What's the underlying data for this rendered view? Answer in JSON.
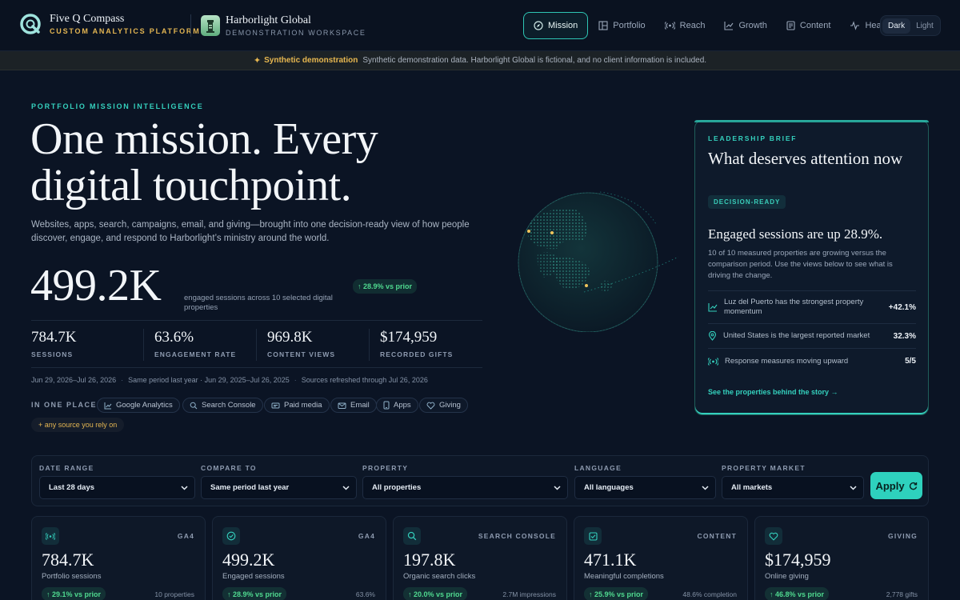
{
  "brand": {
    "name": "Five Q Compass",
    "subtitle": "CUSTOM ANALYTICS PLATFORM"
  },
  "client": {
    "name": "Harborlight Global",
    "subtitle": "DEMONSTRATION WORKSPACE"
  },
  "nav": {
    "items": [
      {
        "label": "Mission",
        "icon": "compass-icon",
        "active": true
      },
      {
        "label": "Portfolio",
        "icon": "grid-icon",
        "active": false
      },
      {
        "label": "Reach",
        "icon": "broadcast-icon",
        "active": false
      },
      {
        "label": "Growth",
        "icon": "trend-up-icon",
        "active": false
      },
      {
        "label": "Content",
        "icon": "document-icon",
        "active": false
      },
      {
        "label": "Health",
        "icon": "pulse-icon",
        "active": false
      }
    ],
    "theme": {
      "dark": "Dark",
      "light": "Light",
      "selected": "Dark"
    }
  },
  "banner": {
    "icon": "sparkle-icon",
    "strong": "Synthetic demonstration",
    "text": "Synthetic demonstration data. Harborlight Global is fictional, and no client information is included."
  },
  "hero": {
    "eyebrow": "PORTFOLIO MISSION INTELLIGENCE",
    "title": "One mission. Every digital touchpoint.",
    "description": "Websites, apps, search, campaigns, email, and giving—brought into one decision-ready view of how people discover, engage, and respond to Harborlight’s ministry around the world."
  },
  "headline_metric": {
    "value": "499.2K",
    "label": "engaged sessions across 10 selected digital properties",
    "change": "↑ 28.9% vs prior"
  },
  "kpis": [
    {
      "value": "784.7K",
      "label": "SESSIONS"
    },
    {
      "value": "63.6%",
      "label": "ENGAGEMENT RATE"
    },
    {
      "value": "969.8K",
      "label": "CONTENT VIEWS"
    },
    {
      "value": "$174,959",
      "label": "RECORDED GIFTS"
    }
  ],
  "meta": {
    "range": "Jun 29, 2026–Jul 26, 2026",
    "compare": "Same period last year · Jun 29, 2025–Jul 26, 2025",
    "refreshed": "Sources refreshed through Jul 26, 2026"
  },
  "sources": {
    "label": "IN ONE PLACE",
    "chips": [
      {
        "label": "Google Analytics",
        "icon": "chart-line-icon"
      },
      {
        "label": "Search Console",
        "icon": "search-icon"
      },
      {
        "label": "Paid media",
        "icon": "ad-icon"
      },
      {
        "label": "Email",
        "icon": "envelope-icon"
      },
      {
        "label": "Apps",
        "icon": "phone-icon"
      },
      {
        "label": "Giving",
        "icon": "heart-icon"
      }
    ],
    "any": "+ any source you rely on"
  },
  "brief": {
    "eyebrow": "LEADERSHIP BRIEF",
    "title": "What deserves attention now",
    "badge": "DECISION-READY",
    "headline": "Engaged sessions are up 28.9%.",
    "text": "10 of 10 measured properties are growing versus the comparison period. Use the views below to see what is driving the change.",
    "rows": [
      {
        "icon": "trend-up-icon",
        "text": "Luz del Puerto has the strongest property momentum",
        "value": "+42.1%"
      },
      {
        "icon": "location-pin-icon",
        "text": "United States is the largest reported market",
        "value": "32.3%"
      },
      {
        "icon": "broadcast-icon",
        "text": "Response measures moving upward",
        "value": "5/5"
      }
    ],
    "link": "See the properties behind the story →"
  },
  "filters": {
    "items": [
      {
        "label": "DATE RANGE",
        "value": "Last 28 days"
      },
      {
        "label": "COMPARE TO",
        "value": "Same period last year"
      },
      {
        "label": "PROPERTY",
        "value": "All properties"
      },
      {
        "label": "LANGUAGE",
        "value": "All languages"
      },
      {
        "label": "PROPERTY MARKET",
        "value": "All markets"
      }
    ],
    "apply": "Apply"
  },
  "cards": [
    {
      "icon": "broadcast-icon",
      "source": "GA4",
      "value": "784.7K",
      "label": "Portfolio sessions",
      "change": "↑ 29.1% vs prior",
      "note": "10 properties"
    },
    {
      "icon": "check-circle-icon",
      "source": "GA4",
      "value": "499.2K",
      "label": "Engaged sessions",
      "change": "↑ 28.9% vs prior",
      "note": "63.6%"
    },
    {
      "icon": "search-icon",
      "source": "SEARCH CONSOLE",
      "value": "197.8K",
      "label": "Organic search clicks",
      "change": "↑ 20.0% vs prior",
      "note": "2.7M impressions"
    },
    {
      "icon": "checkbox-icon",
      "source": "CONTENT",
      "value": "471.1K",
      "label": "Meaningful completions",
      "change": "↑ 25.9% vs prior",
      "note": "48.6% completion"
    },
    {
      "icon": "heart-icon",
      "source": "GIVING",
      "value": "$174,959",
      "label": "Online giving",
      "change": "↑ 46.8% vs prior",
      "note": "2,778 gifts"
    }
  ],
  "colors": {
    "background": "#0b1424",
    "accent": "#2ec6b4",
    "gold": "#e3b552",
    "positive": "#4fd98f"
  }
}
